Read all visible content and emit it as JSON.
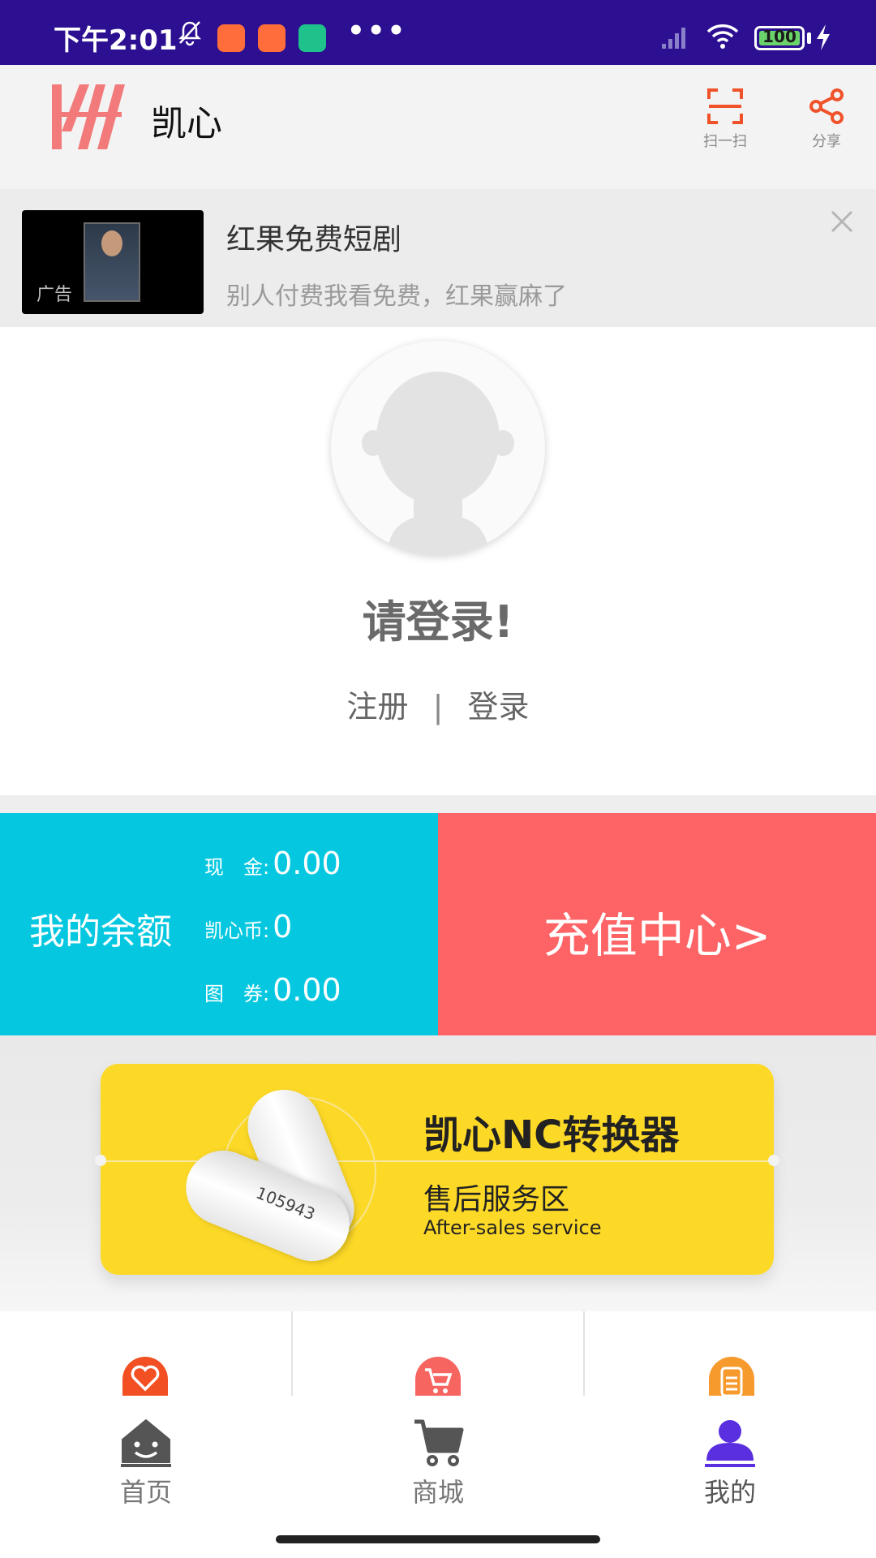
{
  "status_bar": {
    "time": "下午2:01",
    "battery": "100",
    "icons": [
      "mute-bell-icon",
      "app-notification-icon",
      "app-notification-icon",
      "shield-icon",
      "more-dots-icon",
      "signal-icon",
      "wifi-icon",
      "battery-icon",
      "charging-icon"
    ]
  },
  "header": {
    "app_name": "凯心",
    "scan_label": "扫一扫",
    "share_label": "分享",
    "accent_color": "#f0522a"
  },
  "ad": {
    "title": "红果免费短剧",
    "subtitle": "别人付费我看免费，红果赢麻了",
    "tag": "广告"
  },
  "profile": {
    "login_prompt": "请登录!",
    "register_link": "注册",
    "separator": "|",
    "login_link": "登录"
  },
  "balance": {
    "title": "我的余额",
    "rows": [
      {
        "label": "现　金:",
        "value": "0.00"
      },
      {
        "label": "凯心币:",
        "value": "0"
      },
      {
        "label": "图　券:",
        "value": "0.00"
      }
    ],
    "bg_color": "#05c8e0"
  },
  "recharge": {
    "label": "充值中心>",
    "bg_color": "#fe6466"
  },
  "banner": {
    "title": "凯心NC转换器",
    "subtitle": "售后服务区",
    "subtitle_en": "After-sales service",
    "device_number": "105943"
  },
  "bottom_nav": {
    "items": [
      {
        "label": "首页",
        "icon": "home-icon",
        "active": false
      },
      {
        "label": "商城",
        "icon": "cart-icon",
        "active": false
      },
      {
        "label": "我的",
        "icon": "person-icon",
        "active": true
      }
    ],
    "active_color": "#5a2fe0"
  }
}
